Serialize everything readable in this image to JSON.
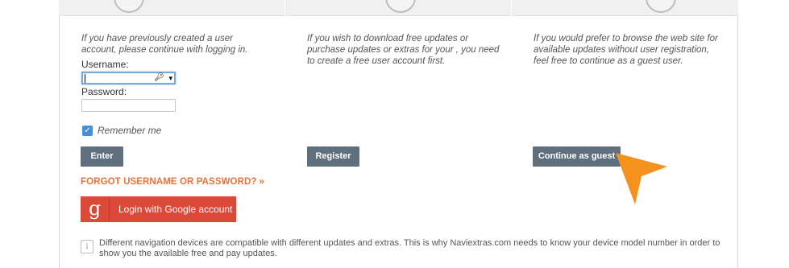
{
  "login": {
    "intro": "If you have previously created a user account, please continue with logging in.",
    "username_label": "Username:",
    "username_value": "",
    "password_label": "Password:",
    "password_value": "",
    "remember_label": "Remember me",
    "remember_checked": true,
    "enter_button": "Enter",
    "forgot_text": "FORGOT USERNAME OR PASSWORD?",
    "forgot_arrows": "»",
    "google_button": "Login with Google account",
    "google_icon": "g-icon"
  },
  "register": {
    "intro": "If you wish to download free updates or purchase updates or extras for your , you need to create a free user account first.",
    "button": "Register"
  },
  "guest": {
    "intro": "If you would prefer to browse the web site for available updates without user registration, feel free to continue as a guest user.",
    "button": "Continue as guest"
  },
  "info": {
    "icon": "i",
    "text": "Different navigation devices are compatible with different updates and extras. This is why Naviextras.com needs to know your device model number in order to show you the available free and pay updates."
  },
  "colors": {
    "accent_orange": "#e8743b",
    "button_gray": "#5f6f7d",
    "google_red": "#db4a39",
    "pointer_orange": "#f5921e",
    "checkbox_blue": "#4a8ed6"
  }
}
